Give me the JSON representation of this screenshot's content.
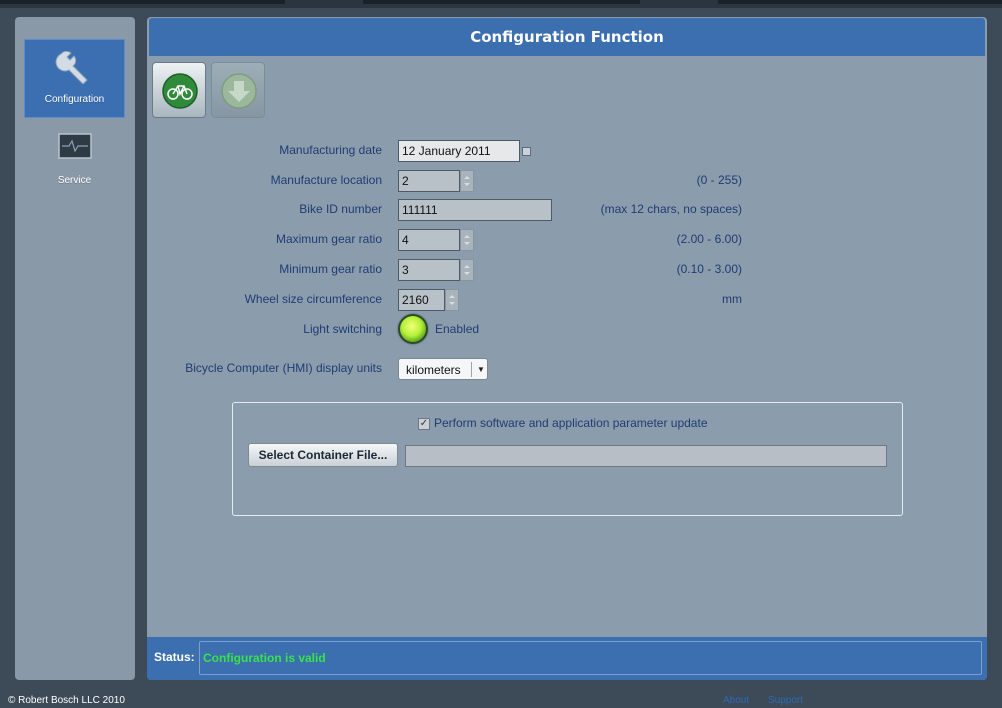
{
  "sidebar": {
    "items": [
      {
        "label": "Configuration",
        "icon": "wrench-icon",
        "active": true
      },
      {
        "label": "Service",
        "icon": "monitor-icon",
        "active": false
      }
    ]
  },
  "header": {
    "title": "Configuration Function"
  },
  "toolbar": {
    "buttons": [
      {
        "icon": "bicycle-icon",
        "enabled": true
      },
      {
        "icon": "download-arrow-icon",
        "enabled": false
      }
    ]
  },
  "form": {
    "manufacturing_date": {
      "label": "Manufacturing date",
      "value": "12 January 2011"
    },
    "manufacture_location": {
      "label": "Manufacture location",
      "value": "2",
      "hint": "(0 - 255)"
    },
    "bike_id": {
      "label": "Bike ID number",
      "value": "111111",
      "hint": "(max 12 chars, no spaces)"
    },
    "max_gear_ratio": {
      "label": "Maximum gear ratio",
      "value": "4",
      "hint": "(2.00 - 6.00)"
    },
    "min_gear_ratio": {
      "label": "Minimum gear ratio",
      "value": "3",
      "hint": "(0.10 - 3.00)"
    },
    "wheel_size": {
      "label": "Wheel size circumference",
      "value": "2160",
      "hint": "mm"
    },
    "light_switching": {
      "label": "Light switching",
      "state": "Enabled"
    },
    "display_units": {
      "label": "Bicycle Computer (HMI) display units",
      "value": "kilometers"
    }
  },
  "update": {
    "checkbox_label": "Perform software and application parameter update",
    "checked": true,
    "select_file_button": "Select Container File...",
    "file_path": ""
  },
  "status": {
    "label": "Status:",
    "text": "Configuration is valid"
  },
  "footer": {
    "copyright": "© Robert Bosch LLC 2010",
    "about": "About",
    "support": "Support"
  },
  "colors": {
    "accent": "#3b6fb0",
    "status_ok": "#37e24a",
    "panel": "#8b9cac"
  }
}
